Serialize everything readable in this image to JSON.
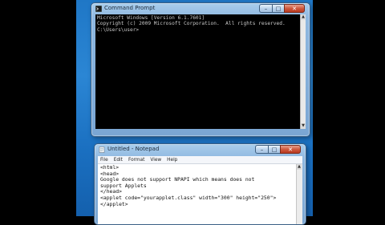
{
  "cmd_window": {
    "title": "Command Prompt",
    "icon": "console-icon",
    "lines": [
      "Microsoft Windows [Version 6.1.7601]",
      "Copyright (c) 2009 Microsoft Corporation.  All rights reserved.",
      "",
      "C:\\Users\\user>"
    ]
  },
  "notepad_window": {
    "title": "Untitled - Notepad",
    "icon": "notepad-icon",
    "menu": [
      "File",
      "Edit",
      "Format",
      "View",
      "Help"
    ],
    "lines": [
      "<html>",
      "<head>",
      "Google does not support NPAPI which means does not",
      "support Applets",
      "</head>",
      "<applet code=\"yourapplet.class\" width=\"300\" height=\"250\">",
      "</applet>"
    ]
  },
  "window_controls": {
    "minimize": "–",
    "maximize": "□",
    "close": "✕"
  },
  "colors": {
    "desktop": "#1f77c6",
    "console_bg": "#000000",
    "console_fg": "#c8c8c8"
  }
}
